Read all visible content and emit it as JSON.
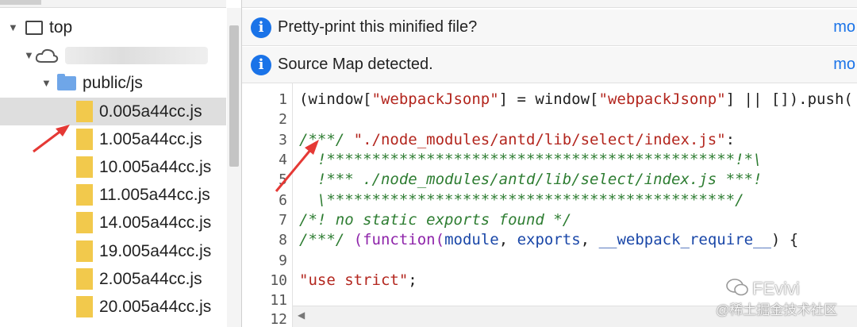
{
  "tree": {
    "root_label": "top",
    "folder_label": "public/js",
    "files": [
      "0.005a44cc.js",
      "1.005a44cc.js",
      "10.005a44cc.js",
      "11.005a44cc.js",
      "14.005a44cc.js",
      "19.005a44cc.js",
      "2.005a44cc.js",
      "20.005a44cc.js"
    ]
  },
  "infobars": [
    {
      "text": "Pretty-print this minified file?",
      "action": "mo"
    },
    {
      "text": "Source Map detected.",
      "action": "mo"
    }
  ],
  "line_numbers": [
    "1",
    "2",
    "3",
    "4",
    "5",
    "6",
    "7",
    "8",
    "9",
    "10",
    "11",
    "12"
  ],
  "code": {
    "l1": {
      "a": "(window[",
      "b": "\"webpackJsonp\"",
      "c": "] = window[",
      "d": "\"webpackJsonp\"",
      "e": "] || []).push("
    },
    "l3": {
      "a": "/***/ ",
      "b": "\"./node_modules/antd/lib/select/index.js\"",
      "c": ":"
    },
    "l4": "  !*********************************************!*\\",
    "l5": "  !*** ./node_modules/antd/lib/select/index.js ***!",
    "l6": "  \\*********************************************/",
    "l7": "/*! no static exports found */",
    "l8": {
      "a": "/***/ ",
      "b": "(",
      "c": "function",
      "d": "(",
      "e": "module",
      "f": ", ",
      "g": "exports",
      "h": ", ",
      "i": "__webpack_require__",
      "j": ") {"
    },
    "l10": {
      "a": "\"use strict\"",
      "b": ";"
    }
  },
  "watermark": {
    "brand": "FEvivi",
    "site": "@稀土掘金技术社区"
  },
  "colors": {
    "info_icon": "#1a73e8",
    "string": "#b3261e",
    "comment": "#2e7d32",
    "keyword": "#8e24aa",
    "arrow": "#e53935"
  }
}
